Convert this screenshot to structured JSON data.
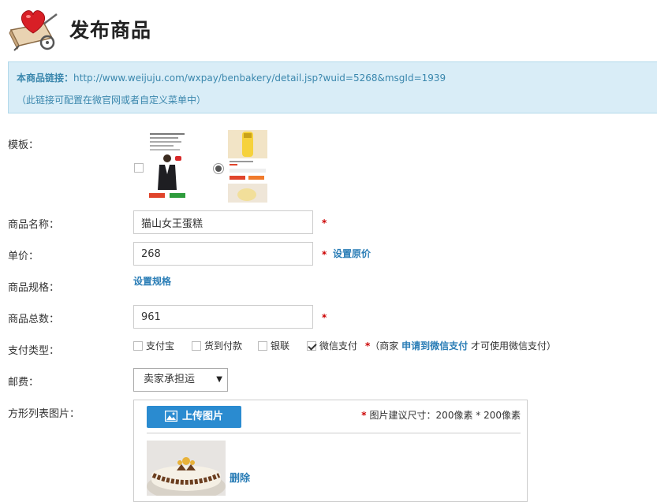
{
  "header": {
    "title": "发布商品",
    "logo_icon": "heart-cart-icon"
  },
  "info": {
    "link_label": "本商品链接：",
    "link_url": "http://www.weijuju.com/wxpay/benbakery/detail.jsp?wuid=5268&msgId=1939",
    "note": "（此链接可配置在微官网或者自定义菜单中）"
  },
  "form": {
    "template_label": "模板：",
    "template_selected": 2,
    "name_label": "商品名称：",
    "name_value": "猫山女王蛋糕",
    "price_label": "单价：",
    "price_value": "268",
    "original_price_link": "设置原价",
    "spec_label": "商品规格：",
    "spec_link": "设置规格",
    "stock_label": "商品总数：",
    "stock_value": "961",
    "required_mark": "*",
    "payment_label": "支付类型：",
    "payment_options": [
      {
        "label": "支付宝",
        "checked": false
      },
      {
        "label": "货到付款",
        "checked": false
      },
      {
        "label": "银联",
        "checked": false
      },
      {
        "label": "微信支付",
        "checked": true
      }
    ],
    "payment_note_prefix": "（商家",
    "payment_note_link": "申请到微信支付",
    "payment_note_suffix": "才可使用微信支付）",
    "shipping_label": "邮费：",
    "shipping_value": "卖家承担运",
    "image_label": "方形列表图片：",
    "upload_button": "上传图片",
    "upload_hint": "图片建议尺寸：200像素 * 200像素",
    "delete_link": "删除"
  },
  "colors": {
    "accent": "#2a8bd0",
    "link": "#2a7db6",
    "required": "#cc0000",
    "info_bg": "#d9edf7"
  }
}
